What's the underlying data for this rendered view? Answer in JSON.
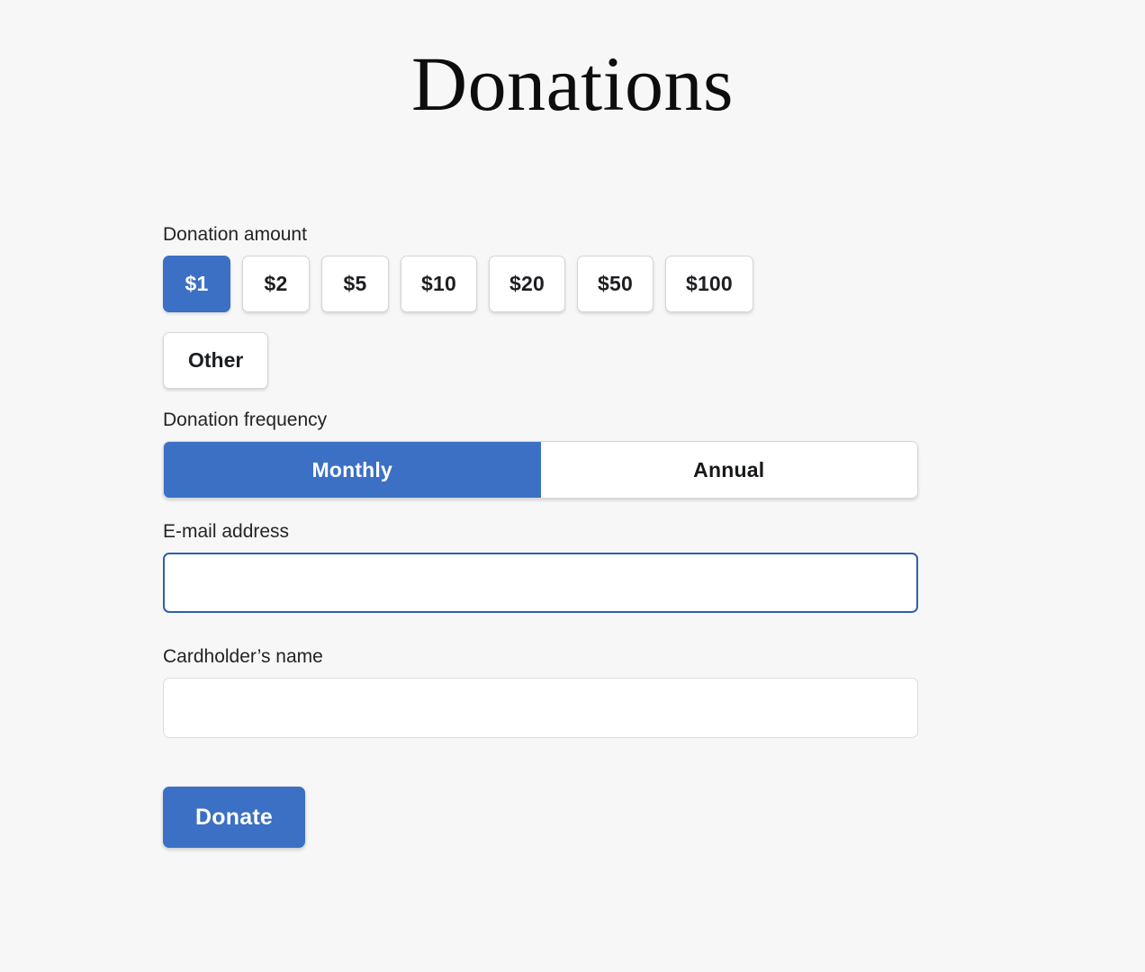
{
  "page": {
    "title": "Donations",
    "background_color": "#f7f7f7",
    "accent_color": "#3b70c4",
    "focus_border_color": "#2d5fb2"
  },
  "form": {
    "amount": {
      "label": "Donation amount",
      "selected": "$1",
      "options": [
        {
          "label": "$1",
          "selected": true
        },
        {
          "label": "$2",
          "selected": false
        },
        {
          "label": "$5",
          "selected": false
        },
        {
          "label": "$10",
          "selected": false
        },
        {
          "label": "$20",
          "selected": false
        },
        {
          "label": "$50",
          "selected": false
        },
        {
          "label": "$100",
          "selected": false
        },
        {
          "label": "Other",
          "selected": false
        }
      ]
    },
    "frequency": {
      "label": "Donation frequency",
      "selected": "Monthly",
      "options": [
        {
          "label": "Monthly",
          "selected": true
        },
        {
          "label": "Annual",
          "selected": false
        }
      ]
    },
    "email": {
      "label": "E-mail address",
      "value": "",
      "placeholder": "",
      "focused": true
    },
    "cardholder": {
      "label": "Cardholder’s name",
      "value": "",
      "placeholder": "",
      "focused": false
    },
    "submit": {
      "label": "Donate"
    }
  }
}
